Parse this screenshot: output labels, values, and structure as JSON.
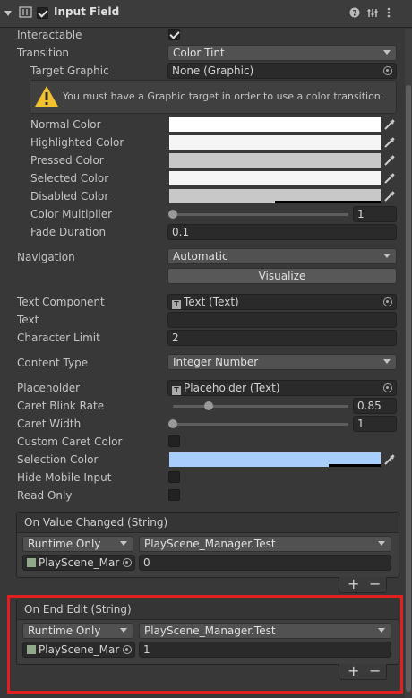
{
  "component": {
    "title": "Input Field",
    "enabled": true,
    "icons": [
      "foldout-arrow-icon",
      "component-icon",
      "help-icon",
      "preset-icon",
      "more-icon"
    ]
  },
  "props": {
    "interactable": {
      "label": "Interactable",
      "checked": true
    },
    "transition": {
      "label": "Transition",
      "value": "Color Tint"
    },
    "target_graphic": {
      "label": "Target Graphic",
      "value": "None (Graphic)"
    },
    "warning": "You must have a Graphic target in order to use a color transition.",
    "normal_color": {
      "label": "Normal Color",
      "color": "#ffffff"
    },
    "highlighted_color": {
      "label": "Highlighted Color",
      "color": "#f5f5f5"
    },
    "pressed_color": {
      "label": "Pressed Color",
      "color": "#c8c8c8"
    },
    "selected_color": {
      "label": "Selected Color",
      "color": "#f5f5f5"
    },
    "disabled_color": {
      "label": "Disabled Color",
      "color": "#c8c8c8",
      "alpha": 0.5
    },
    "color_multiplier": {
      "label": "Color Multiplier",
      "value": "1",
      "slider": 0.0
    },
    "fade_duration": {
      "label": "Fade Duration",
      "value": "0.1"
    },
    "navigation": {
      "label": "Navigation",
      "value": "Automatic"
    },
    "visualize": {
      "label": "Visualize"
    },
    "text_component": {
      "label": "Text Component",
      "value": "Text (Text)"
    },
    "text": {
      "label": "Text",
      "value": ""
    },
    "character_limit": {
      "label": "Character Limit",
      "value": "2"
    },
    "content_type": {
      "label": "Content Type",
      "value": "Integer Number"
    },
    "placeholder": {
      "label": "Placeholder",
      "value": "Placeholder (Text)"
    },
    "caret_blink_rate": {
      "label": "Caret Blink Rate",
      "value": "0.85",
      "slider": 0.21
    },
    "caret_width": {
      "label": "Caret Width",
      "value": "1",
      "slider": 0.0
    },
    "custom_caret_color": {
      "label": "Custom Caret Color",
      "checked": false
    },
    "selection_color": {
      "label": "Selection Color",
      "color": "#a8cefe",
      "alpha": 0.75
    },
    "hide_mobile_input": {
      "label": "Hide Mobile Input",
      "checked": false
    },
    "read_only": {
      "label": "Read Only",
      "checked": false
    }
  },
  "events": [
    {
      "title": "On Value Changed (String)",
      "mode": "Runtime Only",
      "function": "PlayScene_Manager.Test",
      "object": "PlayScene_Mar",
      "argument": "0"
    },
    {
      "title": "On End Edit (String)",
      "mode": "Runtime Only",
      "function": "PlayScene_Manager.Test",
      "object": "PlayScene_Mar",
      "argument": "1"
    }
  ],
  "plus_minus": {
    "plus": "+",
    "minus": "−"
  },
  "highlight_color": "#e02020"
}
